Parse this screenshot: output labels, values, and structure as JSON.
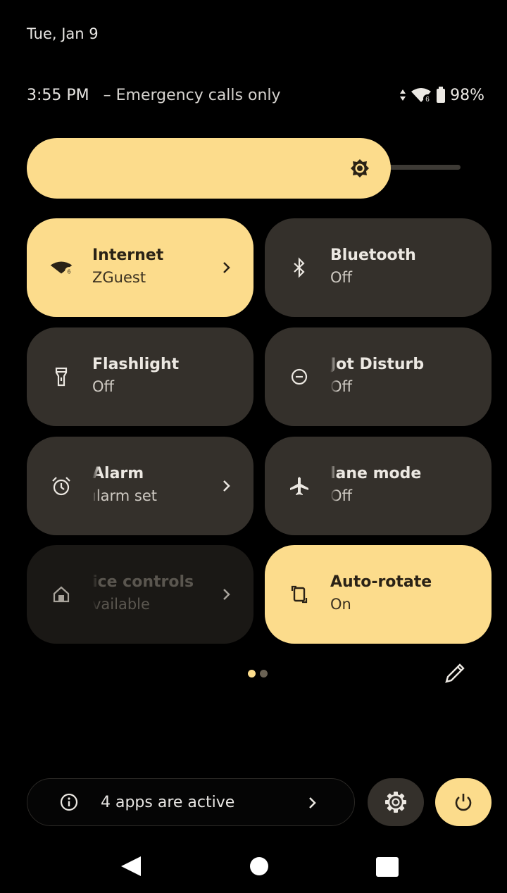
{
  "header": {
    "date": "Tue, Jan 9",
    "time": "3:55 PM",
    "carrier": "– Emergency calls only",
    "battery": "98%",
    "icons": [
      "data-arrows-icon",
      "wifi-icon",
      "battery-icon"
    ]
  },
  "brightness": {
    "level": 0.84,
    "icon": "brightness-icon"
  },
  "tiles": [
    {
      "label": "Internet",
      "sub": "ZGuest",
      "state": "on",
      "icon": "wifi-icon",
      "chevron": true
    },
    {
      "label": "Bluetooth",
      "sub": "Off",
      "state": "off",
      "icon": "bluetooth-icon",
      "chevron": false
    },
    {
      "label": "Flashlight",
      "sub": "Off",
      "state": "off",
      "icon": "flashlight-icon",
      "chevron": false
    },
    {
      "label": "Jot Disturb",
      "sub": "Off",
      "state": "off",
      "icon": "do-not-disturb-icon",
      "chevron": false
    },
    {
      "label": "Alarm",
      "sub": "ılarm set",
      "state": "off",
      "icon": "alarm-icon",
      "chevron": true
    },
    {
      "label": "lane mode",
      "sub": "Off",
      "state": "off",
      "icon": "airplane-icon",
      "chevron": false
    },
    {
      "label": "ice controls",
      "sub": "vailable",
      "state": "unavailable",
      "icon": "home-icon",
      "chevron": true
    },
    {
      "label": "Auto-rotate",
      "sub": "On",
      "state": "on",
      "icon": "auto-rotate-icon",
      "chevron": false
    }
  ],
  "pager": {
    "pages": 2,
    "current": 1
  },
  "footer": {
    "active_apps_label": "4 apps are active"
  },
  "colors": {
    "accent": "#fcdc8c",
    "tile_off": "#34302b",
    "background": "#000000"
  }
}
